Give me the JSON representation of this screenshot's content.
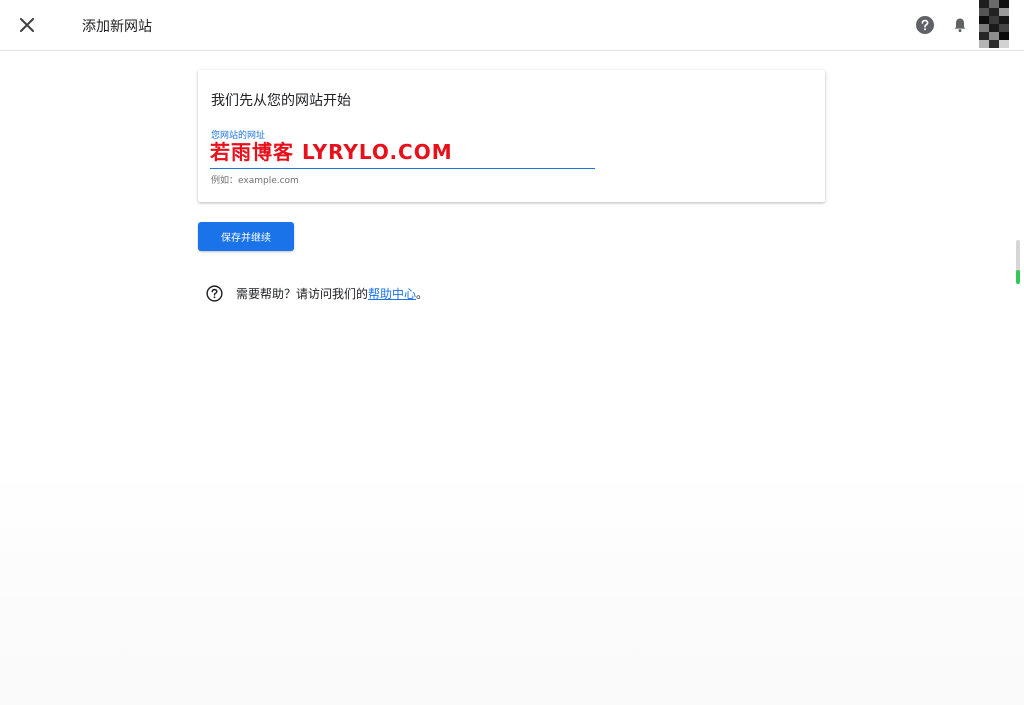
{
  "topbar": {
    "title": "添加新网站"
  },
  "card": {
    "heading": "我们先从您的网站开始",
    "field_label": "您网站的网址",
    "field_value": "若雨博客 LYRYLO.COM",
    "field_hint": "例如：example.com"
  },
  "actions": {
    "save_label": "保存并继续"
  },
  "help": {
    "prefix": "需要帮助？请访问我们的",
    "link": "帮助中心",
    "suffix": "。"
  },
  "colors": {
    "accent": "#1a73e8",
    "watermark_text": "#e8111b"
  },
  "icons": [
    "close-icon",
    "help-circle-icon",
    "bell-icon",
    "avatar",
    "question-icon"
  ]
}
